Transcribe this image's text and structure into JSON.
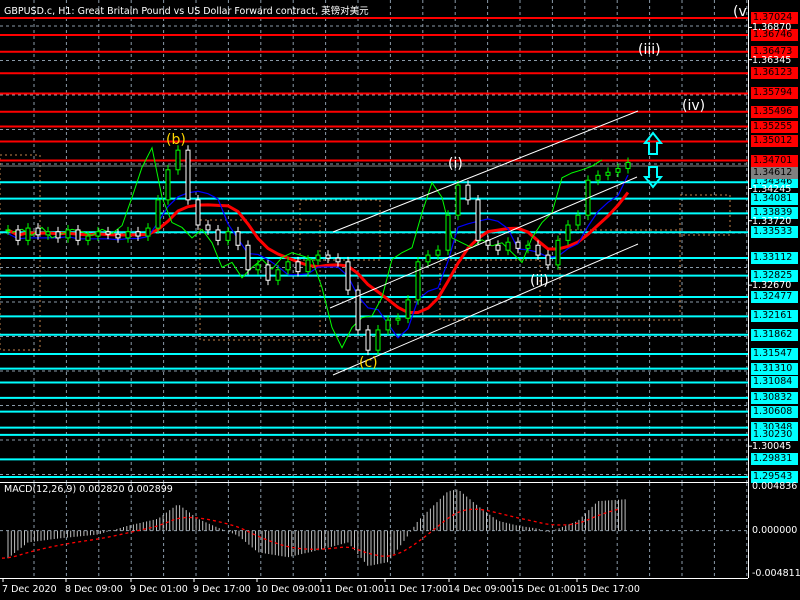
{
  "title": "GBPUSD.c, H1:  Great Britain Pound vs US Dollar Forward contract, 英镑对美元",
  "macd_title": "MACD(12,26,9) 0.002820 0.002899",
  "colors": {
    "resistance": "#ff0000",
    "support": "#00ffff",
    "bull": "#00ff00",
    "bear": "#ffffff",
    "ma": "#ff0000",
    "kijun": "#0000ff",
    "chikou": "#00ff00",
    "cloud": "#f4a460",
    "grid": "#8a9aa8",
    "signal": "#ff0000"
  },
  "price_scale": {
    "max": 1.37024,
    "min": 1.29543
  },
  "resistance_levels": [
    "1.37024",
    "1.36746",
    "1.36473",
    "1.36123",
    "1.35794",
    "1.35496",
    "1.35255",
    "1.35012",
    "1.34701"
  ],
  "support_levels": [
    "1.34346",
    "1.34081",
    "1.33839",
    "1.33533",
    "1.33112",
    "1.32825",
    "1.32477",
    "1.32161",
    "1.31862",
    "1.31547",
    "1.31310",
    "1.31084",
    "1.30832",
    "1.30608",
    "1.30348",
    "1.30230",
    "1.29831",
    "1.29543"
  ],
  "current_price": "1.34612",
  "axis_ticks": [
    "1.36870",
    "1.36345",
    "1.34245",
    "1.33720",
    "1.32670",
    "1.30045"
  ],
  "macd_axis": [
    "0.004836",
    "0.000000",
    "-0.004811"
  ],
  "macd_range": [
    -0.004811,
    0.004836
  ],
  "time_labels": [
    "7 Dec 2020",
    "8 Dec 09:00",
    "9 Dec 01:00",
    "9 Dec 17:00",
    "10 Dec 09:00",
    "11 Dec 01:00",
    "11 Dec 17:00",
    "14 Dec 09:00",
    "15 Dec 01:00",
    "15 Dec 17:00"
  ],
  "waves": [
    {
      "label": "(b)",
      "color": "#ffd700"
    },
    {
      "label": "(c)",
      "color": "#ffd700"
    },
    {
      "label": "(i)",
      "color": "#ffffff"
    },
    {
      "label": "(ii)",
      "color": "#ffffff"
    },
    {
      "label": "(iii)",
      "color": "#ffffff"
    },
    {
      "label": "(iv)",
      "color": "#ffffff"
    },
    {
      "label": "(v",
      "color": "#ffffff"
    }
  ],
  "closes": [
    1.3357,
    1.334,
    1.336,
    1.3349,
    1.3354,
    1.3344,
    1.3357,
    1.334,
    1.3347,
    1.3354,
    1.335,
    1.3344,
    1.3354,
    1.3347,
    1.336,
    1.3406,
    1.3455,
    1.3487,
    1.3406,
    1.3365,
    1.3357,
    1.334,
    1.3354,
    1.3332,
    1.3292,
    1.33,
    1.3275,
    1.3292,
    1.3305,
    1.3289,
    1.3308,
    1.3316,
    1.3311,
    1.3305,
    1.3259,
    1.3194,
    1.3161,
    1.3194,
    1.321,
    1.3213,
    1.3243,
    1.3305,
    1.3316,
    1.3324,
    1.3381,
    1.343,
    1.3406,
    1.334,
    1.3332,
    1.3324,
    1.3337,
    1.3327,
    1.3332,
    1.3316,
    1.33,
    1.334,
    1.3365,
    1.3381,
    1.3438,
    1.3446,
    1.3451,
    1.3457,
    1.3467
  ],
  "macd_hist_keypoints": [
    [
      0,
      -0.0028
    ],
    [
      2,
      -0.0012
    ],
    [
      5,
      -0.0008
    ],
    [
      9,
      -0.0004
    ],
    [
      12,
      0.0005
    ],
    [
      15,
      0.0012
    ],
    [
      17,
      0.0027
    ],
    [
      19,
      0.0012
    ],
    [
      21,
      0.0003
    ],
    [
      23,
      -0.0005
    ],
    [
      25,
      -0.0022
    ],
    [
      28,
      -0.0027
    ],
    [
      31,
      -0.002
    ],
    [
      34,
      -0.0012
    ],
    [
      36,
      -0.0036
    ],
    [
      38,
      -0.0032
    ],
    [
      40,
      -0.0005
    ],
    [
      41,
      0.001
    ],
    [
      44,
      0.004
    ],
    [
      45,
      0.0042
    ],
    [
      47,
      0.0025
    ],
    [
      49,
      0.001
    ],
    [
      51,
      0.0005
    ],
    [
      53,
      0.0002
    ],
    [
      54,
      -0.0002
    ],
    [
      57,
      0.001
    ],
    [
      59,
      0.003
    ],
    [
      62,
      0.0032
    ]
  ]
}
